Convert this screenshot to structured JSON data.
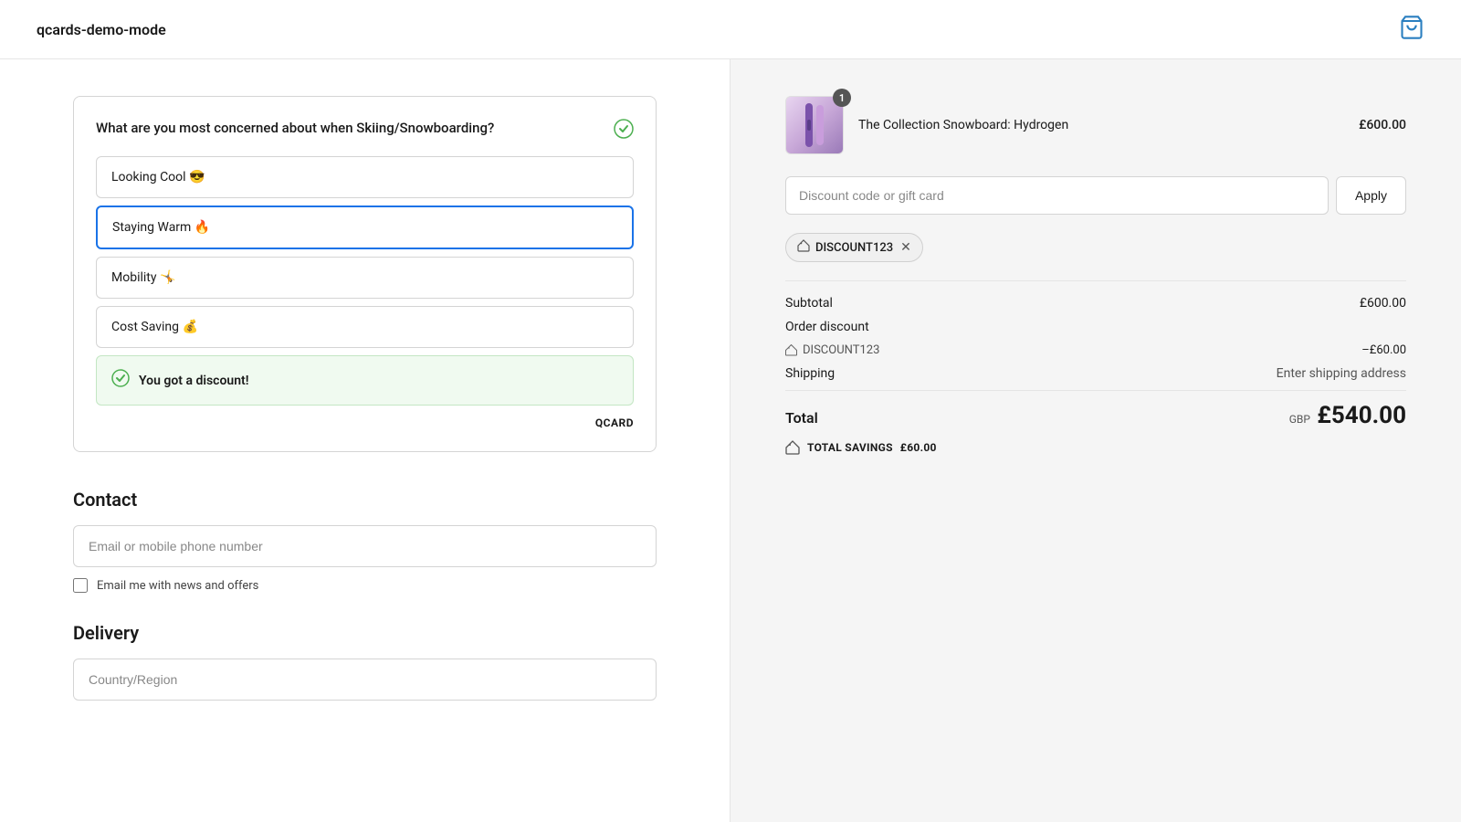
{
  "header": {
    "logo": "qcards-demo-mode",
    "cart_icon": "🛍"
  },
  "qcard": {
    "question": "What are you most concerned about when Skiing/Snowboarding?",
    "check_icon": "✓",
    "options": [
      {
        "id": "looking-cool",
        "label": "Looking Cool 😎",
        "selected": false
      },
      {
        "id": "staying-warm",
        "label": "Staying Warm 🔥",
        "selected": true
      },
      {
        "id": "mobility",
        "label": "Mobility 🤸",
        "selected": false
      },
      {
        "id": "cost-saving",
        "label": "Cost Saving 💰",
        "selected": false
      }
    ],
    "discount_banner": "You got a discount!",
    "brand": "QCARD"
  },
  "contact": {
    "title": "Contact",
    "email_placeholder": "Email or mobile phone number",
    "checkbox_label": "Email me with news and offers"
  },
  "delivery": {
    "title": "Delivery",
    "country_placeholder": "Country/Region"
  },
  "order_summary": {
    "product": {
      "name": "The Collection Snowboard: Hydrogen",
      "price": "£600.00",
      "badge": "1"
    },
    "discount_input_placeholder": "Discount code or gift card",
    "apply_button": "Apply",
    "applied_discount": {
      "code": "DISCOUNT123",
      "icon": "🏷"
    },
    "subtotal_label": "Subtotal",
    "subtotal_value": "£600.00",
    "order_discount_label": "Order discount",
    "discount_code_label": "DISCOUNT123",
    "discount_value": "–£60.00",
    "shipping_label": "Shipping",
    "shipping_value": "Enter shipping address",
    "total_label": "Total",
    "total_currency": "GBP",
    "total_value": "£540.00",
    "savings_label": "TOTAL SAVINGS",
    "savings_value": "£60.00"
  }
}
